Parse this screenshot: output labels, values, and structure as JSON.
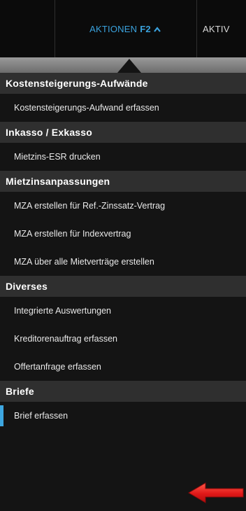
{
  "nav": {
    "tab_aktionen": {
      "label": "AKTIONEN",
      "hotkey": "F2",
      "chevron": "▲"
    },
    "tab_aktiv": {
      "label": "AKTIV"
    }
  },
  "menu": {
    "sections": [
      {
        "title": "Kostensteigerungs-Aufwände",
        "items": [
          "Kostensteigerungs-Aufwand erfassen"
        ]
      },
      {
        "title": "Inkasso / Exkasso",
        "items": [
          "Mietzins-ESR drucken"
        ]
      },
      {
        "title": "Mietzinsanpassungen",
        "items": [
          "MZA erstellen für Ref.-Zinssatz-Vertrag",
          "MZA erstellen für Indexvertrag",
          "MZA über alle Mietverträge erstellen"
        ]
      },
      {
        "title": "Diverses",
        "items": [
          "Integrierte Auswertungen",
          "Kreditorenauftrag erfassen",
          "Offertanfrage erfassen"
        ]
      },
      {
        "title": "Briefe",
        "items": [
          "Brief erfassen"
        ]
      }
    ]
  },
  "colors": {
    "accent": "#3aa2dd",
    "annotation": "#e02020"
  },
  "icons": {
    "chevron": "chevron-up-icon",
    "annotation": "red-arrow-icon"
  }
}
